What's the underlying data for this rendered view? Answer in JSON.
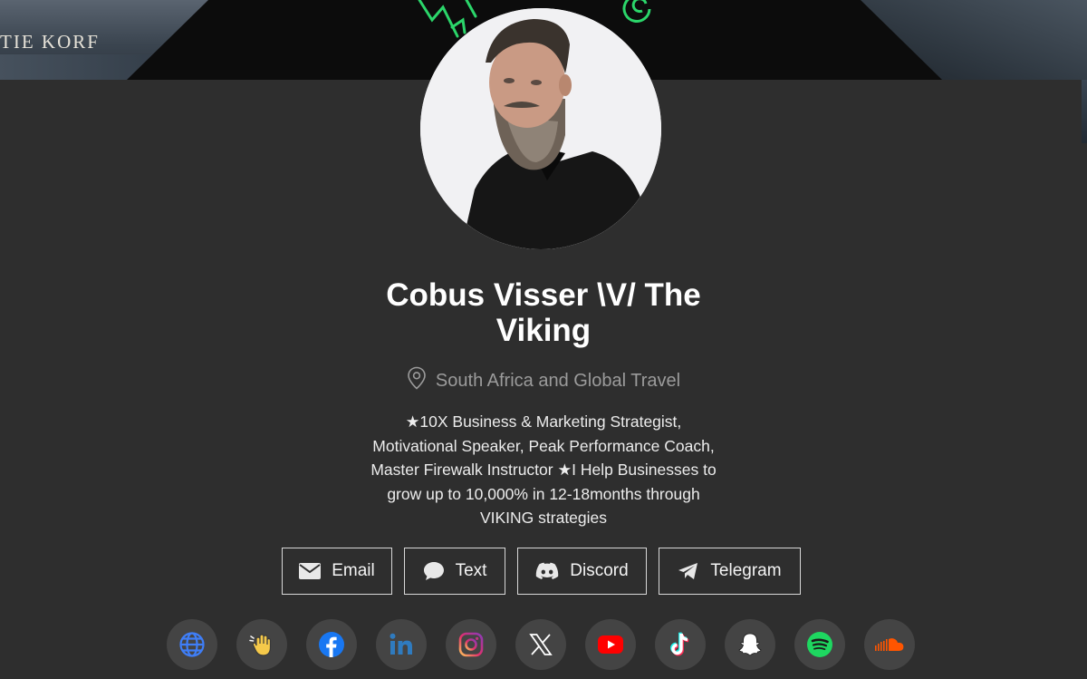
{
  "banner": {
    "brand_text": "TIE KORF"
  },
  "profile": {
    "name_line1": "Cobus Visser \\V/ The",
    "name_line2": "Viking",
    "location": "South Africa and Global Travel",
    "bio_lines": [
      "★10X Business & Marketing Strategist,",
      "Motivational Speaker, Peak Performance Coach,",
      "Master Firewalk Instructor ★I Help Businesses to",
      "grow up to 10,000% in 12-18months through",
      "VIKING strategies"
    ]
  },
  "contact_buttons": [
    {
      "label": "Email",
      "icon": "envelope-icon"
    },
    {
      "label": "Text",
      "icon": "chat-bubble-icon"
    },
    {
      "label": "Discord",
      "icon": "discord-icon"
    },
    {
      "label": "Telegram",
      "icon": "telegram-icon"
    }
  ],
  "social_links": [
    {
      "icon": "globe-icon",
      "color": "#3f7ef7"
    },
    {
      "icon": "waving-hand-icon",
      "color": "#f5c94a"
    },
    {
      "icon": "facebook-icon",
      "color": "#1877f2"
    },
    {
      "icon": "linkedin-icon",
      "color": "#2f7bbf"
    },
    {
      "icon": "instagram-icon",
      "color": "#e1306c"
    },
    {
      "icon": "x-icon",
      "color": "#ffffff"
    },
    {
      "icon": "youtube-icon",
      "color": "#ff0000"
    },
    {
      "icon": "tiktok-icon",
      "color": "#ffffff"
    },
    {
      "icon": "snapchat-icon",
      "color": "#ffffff"
    },
    {
      "icon": "spotify-icon",
      "color": "#1ed760"
    },
    {
      "icon": "soundcloud-icon",
      "color": "#ff5500"
    }
  ]
}
